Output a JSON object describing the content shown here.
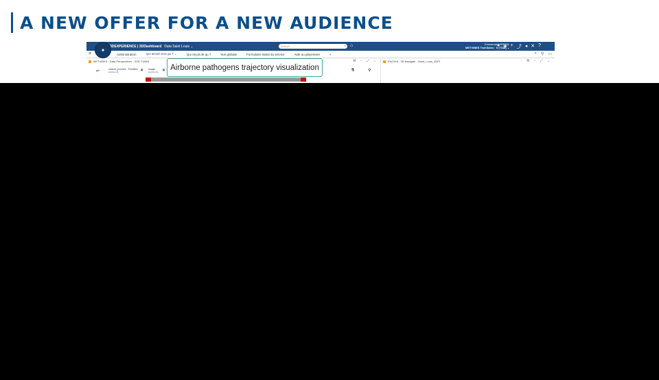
{
  "slide": {
    "title": "A NEW OFFER FOR A NEW AUDIENCE"
  },
  "app": {
    "brand": "3DEXPERIENCE | 3DDashboard",
    "dashboard_name": "Data Saint Louis ⌄",
    "search_placeholder": "Search",
    "user_name": "Emmanuel VIRRIOL",
    "user_org": "METVIBES TechSales · S (T&M) ⌄",
    "tabs": [
      "Administration",
      "Qui aimait vera qu ? ⌄",
      "Qui reçoit de qu ?",
      "Vue globale",
      "Formulaire statut du service",
      "Aide au placement",
      "+"
    ],
    "widget_left": {
      "title": "METVIBES - Data Perspectives - ZOE FUNDI",
      "chip1": "Indices_proches - Emetteur",
      "chip1_sub": "proches 25",
      "chip2": "Image",
      "chip2_sub": "proches 10"
    },
    "widget_right": {
      "title": "ENOVIA - 3D Navigate - Saint_Louis_3DPI"
    }
  },
  "tooltip": {
    "text": "Airborne pathogens trajectory visualization"
  },
  "colors": {
    "title_blue": "#0b4f8a",
    "topbar": "#1d4f86",
    "tooltip_border": "#3ea6a0",
    "red_marker": "#d00000"
  }
}
